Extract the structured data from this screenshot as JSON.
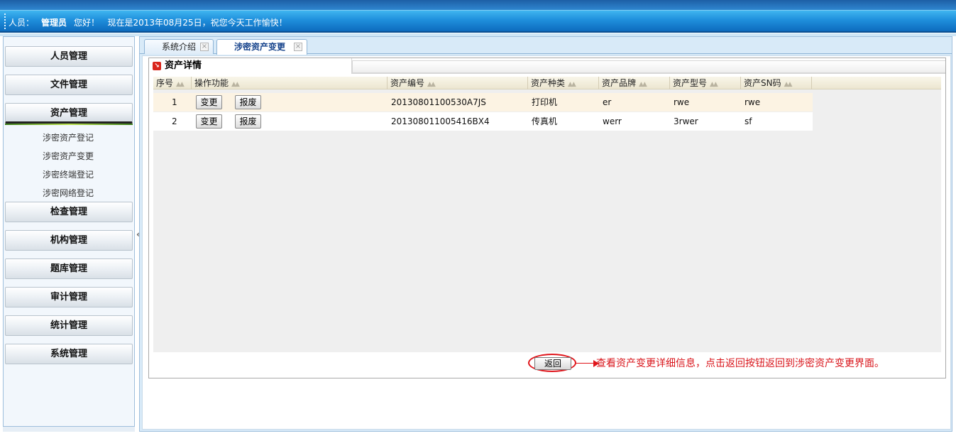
{
  "header": {
    "user_label": "人员：",
    "user_name": "管理员",
    "hello": "您好！",
    "date_text": "现在是2013年08月25日，祝您今天工作愉快！"
  },
  "sidebar": {
    "menus": [
      {
        "label": "人员管理"
      },
      {
        "label": "文件管理"
      },
      {
        "label": "资产管理"
      },
      {
        "label": "检查管理"
      },
      {
        "label": "机构管理"
      },
      {
        "label": "题库管理"
      },
      {
        "label": "审计管理"
      },
      {
        "label": "统计管理"
      },
      {
        "label": "系统管理"
      }
    ],
    "sub_items": [
      {
        "label": "涉密资产登记"
      },
      {
        "label": "涉密资产变更"
      },
      {
        "label": "涉密终端登记"
      },
      {
        "label": "涉密网络登记"
      }
    ],
    "collapse_glyph": "«"
  },
  "tabs": [
    {
      "label": "系统介绍"
    },
    {
      "label": "涉密资产变更"
    }
  ],
  "detail": {
    "title": "资产详情",
    "columns": [
      "序号",
      "操作功能",
      "资产编号",
      "资产种类",
      "资产品牌",
      "资产型号",
      "资产SN码"
    ],
    "rows": [
      {
        "no": "1",
        "change": "变更",
        "scrap": "报废",
        "code": "20130801100530A7JS",
        "type": "打印机",
        "brand": "er",
        "model": "rwe",
        "sn": "rwe"
      },
      {
        "no": "2",
        "change": "变更",
        "scrap": "报废",
        "code": "201308011005416BX4",
        "type": "传真机",
        "brand": "werr",
        "model": "3rwer",
        "sn": "sf"
      }
    ],
    "return_label": "返回",
    "annotation": "查看资产变更详细信息，点击返回按钮返回到涉密资产变更界面。"
  },
  "colors": {
    "header_blue": "#1f8fdc",
    "annotation_red": "#d9151b",
    "row_odd": "#fcf3e3"
  }
}
